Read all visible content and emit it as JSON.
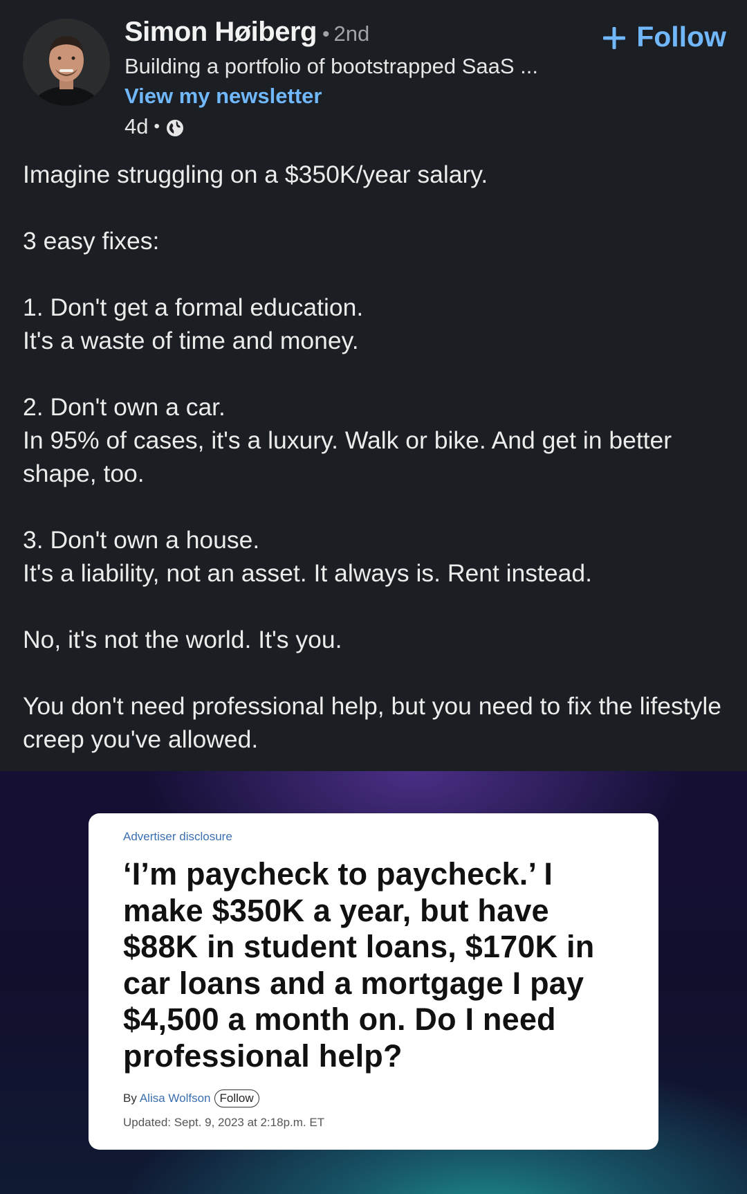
{
  "author": {
    "name": "Simon Høiberg",
    "degree": "2nd",
    "headline": "Building a portfolio of bootstrapped SaaS ...",
    "newsletter_link": "View my newsletter",
    "age": "4d",
    "visibility_icon": "globe-icon"
  },
  "follow_button": {
    "label": "Follow",
    "icon": "plus-icon"
  },
  "post": {
    "lines": {
      "intro": "Imagine struggling on a $350K/year salary.",
      "fixes_title": "3 easy fixes:",
      "fix1_title": "1. Don't get a formal education.",
      "fix1_body": "It's a waste of time and money.",
      "fix2_title": "2. Don't own a car.",
      "fix2_body": "In 95% of cases, it's a luxury. Walk or bike. And get in better shape, too.",
      "fix3_title": "3. Don't own a house.",
      "fix3_body": "It's a liability, not an asset. It always is. Rent instead.",
      "conclusion": "No, it's not the world. It's you.",
      "closing": "You don't need professional help, but you need to fix the lifestyle creep you've allowed."
    }
  },
  "article": {
    "disclosure": "Advertiser disclosure",
    "headline": "‘I’m paycheck to paycheck.’ I make $350K a year, but have $88K in student loans, $170K in car loans and a mortgage I pay $4,500 a month on. Do I need professional help?",
    "byline_prefix": "By",
    "byline_author": "Alisa Wolfson",
    "byline_follow": "Follow",
    "updated": "Updated: Sept. 9, 2023 at 2:18p.m. ET"
  },
  "colors": {
    "background": "#1b1f23",
    "link": "#71b7fb",
    "text": "#ececec",
    "muted": "#a0a4a8"
  }
}
